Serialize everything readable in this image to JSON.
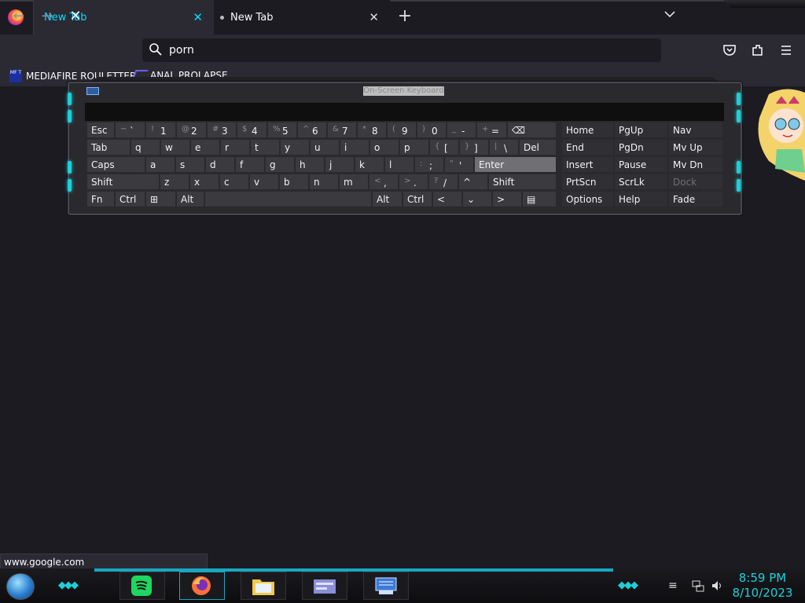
{
  "browser": {
    "tabs": [
      {
        "label": "New Tab",
        "active": true
      },
      {
        "label": "New Tab",
        "active": false
      }
    ],
    "new_tab_icon": "plus-icon",
    "url": "porn",
    "bookmarks": [
      {
        "label": "MEDIAFIRE ROULETTER",
        "icon_text": "MF T"
      },
      {
        "label": "ANAL PROLAPSE"
      }
    ],
    "status_url": "www.google.com"
  },
  "osk": {
    "title": "On-Screen Keyboard",
    "row1": [
      {
        "main": "Esc"
      },
      {
        "sub": "~",
        "main": "`"
      },
      {
        "sub": "!",
        "main": "1"
      },
      {
        "sub": "@",
        "main": "2"
      },
      {
        "sub": "#",
        "main": "3"
      },
      {
        "sub": "$",
        "main": "4"
      },
      {
        "sub": "%",
        "main": "5"
      },
      {
        "sub": "^",
        "main": "6"
      },
      {
        "sub": "&",
        "main": "7"
      },
      {
        "sub": "*",
        "main": "8"
      },
      {
        "sub": "(",
        "main": "9"
      },
      {
        "sub": ")",
        "main": "0"
      },
      {
        "sub": "_",
        "main": "-"
      },
      {
        "sub": "+",
        "main": "="
      },
      {
        "main": "⌫"
      }
    ],
    "row2": [
      {
        "main": "Tab"
      },
      {
        "main": "q"
      },
      {
        "main": "w"
      },
      {
        "main": "e"
      },
      {
        "main": "r"
      },
      {
        "main": "t"
      },
      {
        "main": "y"
      },
      {
        "main": "u"
      },
      {
        "main": "i"
      },
      {
        "main": "o"
      },
      {
        "main": "p"
      },
      {
        "sub": "{",
        "main": "["
      },
      {
        "sub": "}",
        "main": "]"
      },
      {
        "sub": "|",
        "main": "\\"
      },
      {
        "main": "Del"
      }
    ],
    "row3": [
      {
        "main": "Caps"
      },
      {
        "main": "a"
      },
      {
        "main": "s"
      },
      {
        "main": "d"
      },
      {
        "main": "f"
      },
      {
        "main": "g"
      },
      {
        "main": "h"
      },
      {
        "main": "j"
      },
      {
        "main": "k"
      },
      {
        "main": "l"
      },
      {
        "sub": ":",
        "main": ";"
      },
      {
        "sub": "\"",
        "main": "'"
      },
      {
        "main": "Enter"
      }
    ],
    "row4": [
      {
        "main": "Shift"
      },
      {
        "main": "z"
      },
      {
        "main": "x"
      },
      {
        "main": "c"
      },
      {
        "main": "v"
      },
      {
        "main": "b"
      },
      {
        "main": "n"
      },
      {
        "main": "m"
      },
      {
        "sub": "<",
        "main": ","
      },
      {
        "sub": ">",
        "main": "."
      },
      {
        "sub": "?",
        "main": "/"
      },
      {
        "main": "^"
      },
      {
        "main": "Shift"
      }
    ],
    "row5": [
      {
        "main": "Fn"
      },
      {
        "main": "Ctrl"
      },
      {
        "main": "⊞"
      },
      {
        "main": "Alt"
      },
      {
        "main": ""
      },
      {
        "main": "Alt"
      },
      {
        "main": "Ctrl"
      },
      {
        "main": "<"
      },
      {
        "main": "⌄"
      },
      {
        "main": ">"
      },
      {
        "main": "▤"
      }
    ],
    "nav": [
      [
        "Home",
        "PgUp",
        "Nav"
      ],
      [
        "End",
        "PgDn",
        "Mv Up"
      ],
      [
        "Insert",
        "Pause",
        "Mv Dn"
      ],
      [
        "PrtScn",
        "ScrLk",
        "Dock"
      ],
      [
        "Options",
        "Help",
        "Fade"
      ]
    ]
  },
  "taskbar": {
    "time": "8:59 PM",
    "date": "8/10/2023"
  },
  "colors": {
    "accent": "#00ddff",
    "glow": "#1dcfd8",
    "bg": "#1c1b22",
    "toolbar": "#2b2a33"
  }
}
